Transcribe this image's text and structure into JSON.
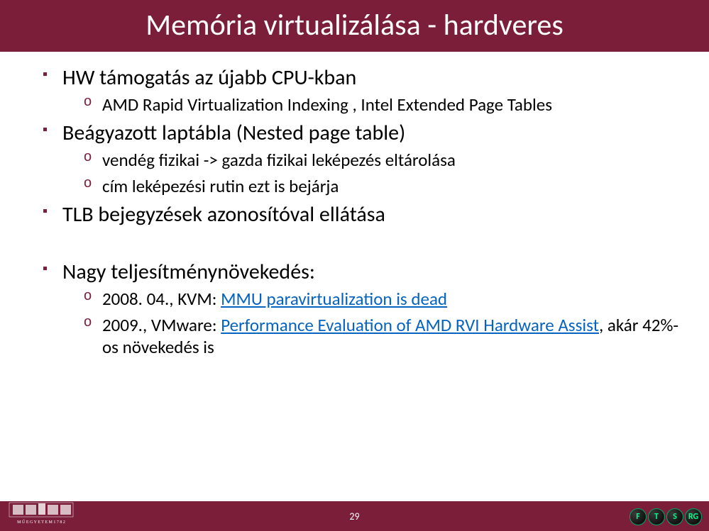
{
  "header": {
    "title": "Memória virtualizálása - hardveres"
  },
  "content": {
    "items": [
      {
        "text": "HW támogatás az újabb CPU-kban",
        "subitems": [
          {
            "text": "AMD Rapid Virtualization Indexing , Intel Extended Page Tables"
          }
        ]
      },
      {
        "text": "Beágyazott laptábla (Nested page table)",
        "subitems": [
          {
            "text": "vendég fizikai -> gazda fizikai leképezés eltárolása"
          },
          {
            "text": "cím leképezési rutin ezt is bejárja"
          }
        ]
      },
      {
        "text": "TLB bejegyzések azonosítóval ellátása",
        "subitems": []
      },
      {
        "text": "Nagy teljesítménynövekedés:",
        "subitems": [
          {
            "prefix": "2008. 04., KVM: ",
            "link": "MMU paravirtualization is dead",
            "suffix": ""
          },
          {
            "prefix": "2009., VMware: ",
            "link": "Performance Evaluation of AMD RVI Hardware Assist",
            "suffix": ", akár 42%-os növekedés is"
          }
        ]
      }
    ]
  },
  "footer": {
    "page": "29",
    "badges": [
      "F",
      "T",
      "S",
      "RG"
    ]
  }
}
